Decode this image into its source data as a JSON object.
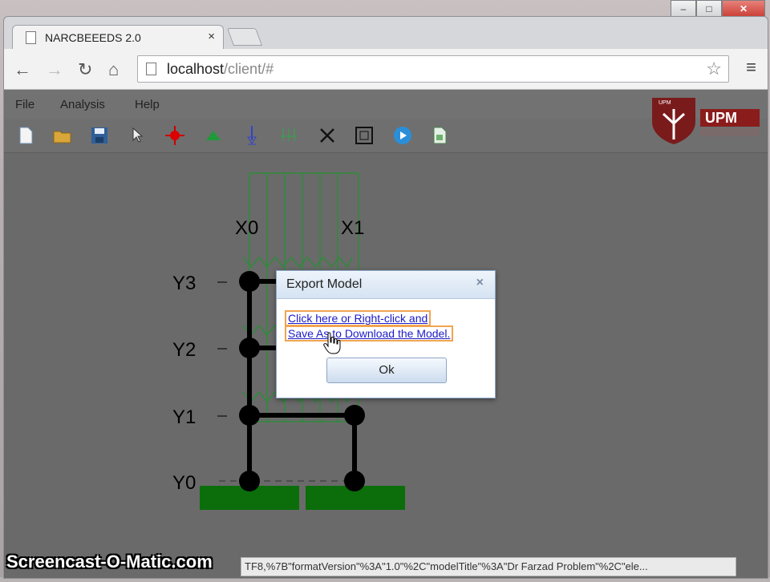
{
  "browser": {
    "tab_title": "NARCBEEEDS 2.0",
    "tab_close": "×",
    "url_host": "localhost",
    "url_path": "/client/#",
    "status_text": "TF8,%7B\"formatVersion\"%3A\"1.0\"%2C\"modelTitle\"%3A\"Dr Farzad Problem\"%2C\"ele..."
  },
  "app": {
    "menu": [
      "File",
      "Analysis",
      "Help"
    ],
    "logo_text": "UPM",
    "logo_badge": "UPM",
    "toolbar_icons": [
      "new-file-icon",
      "open-folder-icon",
      "save-icon",
      "select-pointer-icon",
      "node-icon",
      "support-icon",
      "load-arrow-icon",
      "distributed-load-icon",
      "delete-icon",
      "fit-view-icon",
      "run-icon",
      "report-icon"
    ]
  },
  "model": {
    "x_labels": [
      "X0",
      "X1"
    ],
    "y_labels": [
      "Y3",
      "Y2",
      "Y1",
      "Y0"
    ]
  },
  "dialog": {
    "title": "Export Model",
    "close": "×",
    "link_line1": "Click here or Right-click and",
    "link_line2": "Save As to Download the Model.",
    "ok": "Ok"
  },
  "watermark": "Screencast-O-Matic.com",
  "colors": {
    "member": "#000000",
    "load": "#2e8b3a",
    "support": "#0b6e0b"
  }
}
